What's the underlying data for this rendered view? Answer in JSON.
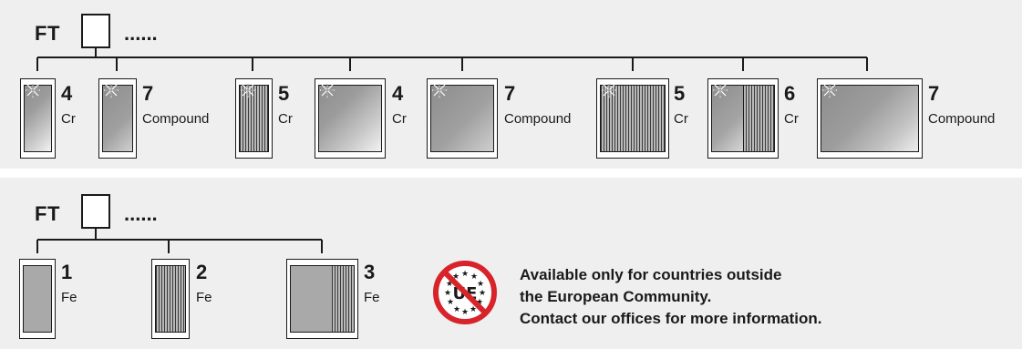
{
  "top_group": {
    "code_label": "FT",
    "code_suffix": "......",
    "items": [
      {
        "number": "4",
        "material": "Cr"
      },
      {
        "number": "7",
        "material": "Compound"
      },
      {
        "number": "5",
        "material": "Cr"
      },
      {
        "number": "4",
        "material": "Cr"
      },
      {
        "number": "7",
        "material": "Compound"
      },
      {
        "number": "5",
        "material": "Cr"
      },
      {
        "number": "6",
        "material": "Cr"
      },
      {
        "number": "7",
        "material": "Compound"
      }
    ]
  },
  "bottom_group": {
    "code_label": "FT",
    "code_suffix": "......",
    "items": [
      {
        "number": "1",
        "material": "Fe"
      },
      {
        "number": "2",
        "material": "Fe"
      },
      {
        "number": "3",
        "material": "Fe"
      }
    ]
  },
  "notice": {
    "icon_text": "UE",
    "line1": "Available only for countries outside",
    "line2": "the European Community.",
    "line3": "Contact our offices for more information."
  },
  "colors": {
    "panel_bg": "#efefef",
    "prohibit_red": "#d8232a",
    "ink": "#1a1a1a"
  }
}
